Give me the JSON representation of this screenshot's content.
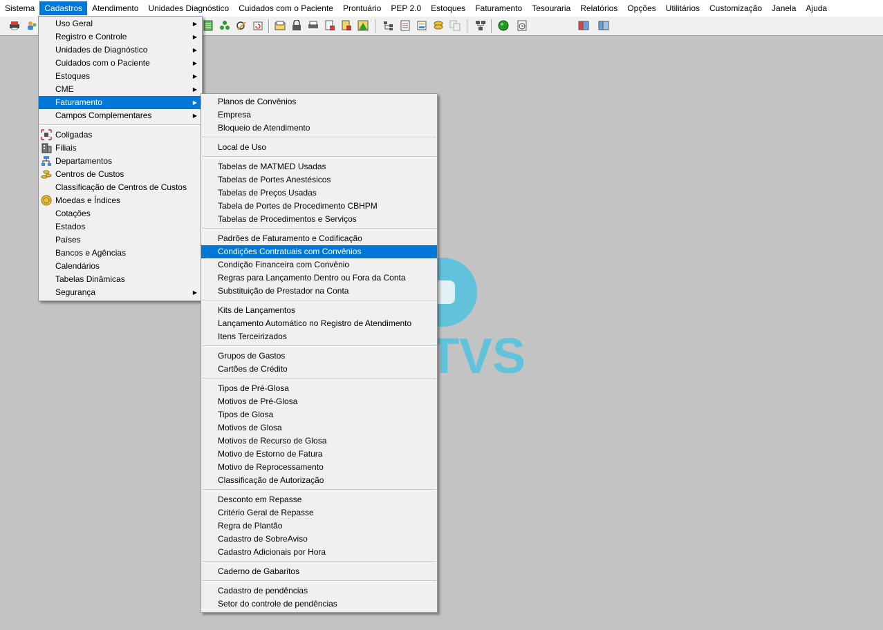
{
  "menubar": {
    "items": [
      "Sistema",
      "Cadastros",
      "Atendimento",
      "Unidades Diagnóstico",
      "Cuidados com o Paciente",
      "Prontuário",
      "PEP 2.0",
      "Estoques",
      "Faturamento",
      "Tesouraria",
      "Relatórios",
      "Opções",
      "Utilitários",
      "Customização",
      "Janela",
      "Ajuda"
    ],
    "active": "Cadastros"
  },
  "colors": {
    "highlight": "#0078d7",
    "background": "#c3c3c3",
    "menu_bg": "#f0f0f0",
    "logo_blue": "#4fc2e0"
  },
  "logo": {
    "text": "TVS"
  },
  "cadastros_menu": {
    "group1": [
      "Uso Geral",
      "Registro e Controle",
      "Unidades de Diagnóstico",
      "Cuidados com o Paciente",
      "Estoques",
      "CME",
      "Faturamento",
      "Campos Complementares"
    ],
    "group2": [
      "Coligadas",
      "Filiais",
      "Departamentos",
      "Centros de Custos",
      "Classificação de Centros de Custos",
      "Moedas e Índices",
      "Cotações",
      "Estados",
      "Países",
      "Bancos e Agências",
      "Calendários",
      "Tabelas Dinâmicas",
      "Segurança"
    ],
    "selected": "Faturamento"
  },
  "faturamento_menu": {
    "g1": [
      "Planos de Convênios",
      "Empresa",
      "Bloqueio de Atendimento"
    ],
    "g2": [
      "Local de Uso"
    ],
    "g3": [
      "Tabelas de MATMED Usadas",
      "Tabelas de Portes Anestésicos",
      "Tabelas de Preços Usadas",
      "Tabela de Portes de Procedimento CBHPM",
      "Tabelas de Procedimentos e Serviços"
    ],
    "g4": [
      "Padrões de Faturamento e Codificação",
      "Condições Contratuais com Convênios",
      "Condição Financeira com Convênio",
      "Regras para Lançamento Dentro ou Fora da Conta",
      "Substituição de Prestador na Conta"
    ],
    "g5": [
      "Kits de Lançamentos",
      "Lançamento Automático no Registro de Atendimento",
      "Itens Terceirizados"
    ],
    "g6": [
      "Grupos de Gastos",
      "Cartões de Crédito"
    ],
    "g7": [
      "Tipos de Pré-Glosa",
      "Motivos de Pré-Glosa",
      "Tipos de Glosa",
      "Motivos de Glosa",
      "Motivos de Recurso de Glosa",
      "Motivo de Estorno de Fatura",
      "Motivo de Reprocessamento",
      "Classificação de Autorização"
    ],
    "g8": [
      "Desconto em Repasse",
      "Critério Geral de Repasse",
      "Regra de Plantão",
      "Cadastro de SobreAviso",
      "Cadastro Adicionais por Hora"
    ],
    "g9": [
      "Caderno de Gabaritos"
    ],
    "g10": [
      "Cadastro de pendências",
      "Setor do controle de pendências"
    ],
    "selected": "Condições Contratuais com Convênios"
  }
}
